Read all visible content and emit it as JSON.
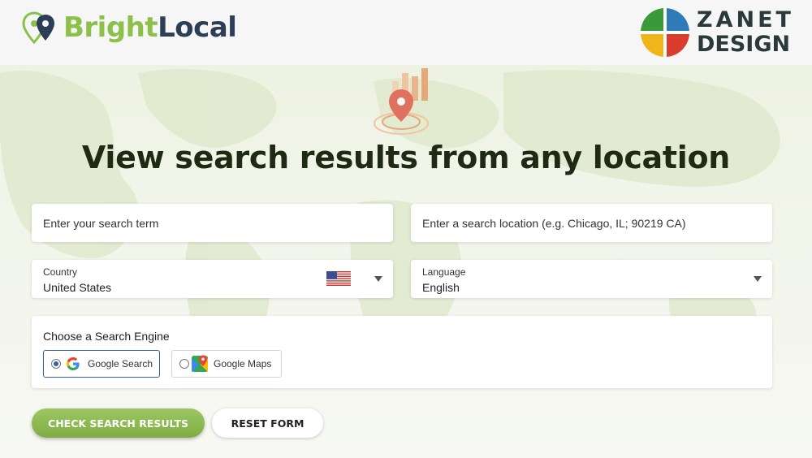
{
  "header": {
    "brand_part1": "Bright",
    "brand_part2": "Local",
    "partner_line1": "ZANET",
    "partner_line2": "DESIGN"
  },
  "hero": {
    "headline": "View search results from any location"
  },
  "form": {
    "search_term_placeholder": "Enter your search term",
    "location_placeholder": "Enter a search location (e.g. Chicago, IL; 90219 CA)",
    "country": {
      "label": "Country",
      "value": "United States",
      "flag_icon": "us-flag-icon"
    },
    "language": {
      "label": "Language",
      "value": "English"
    },
    "engine": {
      "title": "Choose a Search Engine",
      "options": [
        {
          "label": "Google Search",
          "selected": true,
          "icon": "google-icon"
        },
        {
          "label": "Google Maps",
          "selected": false,
          "icon": "google-maps-icon"
        }
      ]
    },
    "submit_label": "CHECK SEARCH RESULTS",
    "reset_label": "RESET FORM"
  },
  "colors": {
    "brand_green": "#8cc04b",
    "brand_navy": "#2c3e55",
    "selected_border": "#2f5fb0",
    "pin_color": "#e07060"
  }
}
